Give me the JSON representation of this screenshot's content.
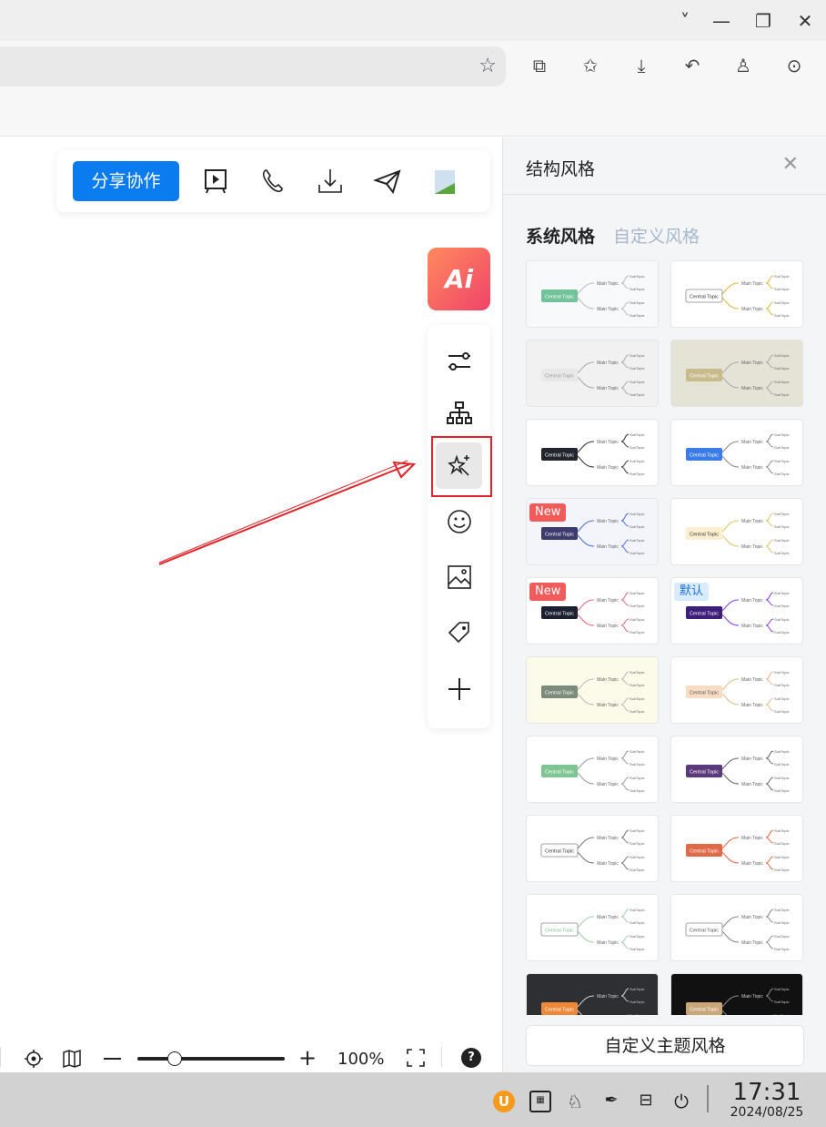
{
  "window": {
    "controls": [
      "chevron-down",
      "minimize",
      "restore",
      "close"
    ]
  },
  "browser": {
    "icons": [
      "extensions-icon",
      "collections-icon",
      "download-icon",
      "undo-icon",
      "profile-icon",
      "more-icon"
    ]
  },
  "toolbar": {
    "share_label": "分享协作",
    "icons": [
      "present-icon",
      "call-icon",
      "export-icon",
      "send-icon",
      "image-icon"
    ]
  },
  "ai": {
    "label": "Ai"
  },
  "sidetools": [
    "adjust-icon",
    "structure-icon",
    "magic-style-icon",
    "emoji-icon",
    "image-icon",
    "tag-icon",
    "add-icon"
  ],
  "bottom": {
    "zoom_percent": "100%",
    "zoom_level": 0.25,
    "help": "?"
  },
  "panel": {
    "title": "结构风格",
    "tabs": [
      {
        "label": "系统风格",
        "active": true
      },
      {
        "label": "自定义风格",
        "active": false
      }
    ],
    "thumb_text": {
      "central": "Central Topic",
      "main": "Main Topic",
      "sub": "SubTopic"
    },
    "themes": [
      {
        "bg": "#f8f9fa",
        "central": "#72c29a",
        "ctext": "#fff",
        "line": "#bbb"
      },
      {
        "bg": "#ffffff",
        "central": "#ffffff",
        "ctext": "#333",
        "line": "#e0b83a"
      },
      {
        "bg": "#f1f1f1",
        "central": "#e8e8e8",
        "ctext": "#999",
        "line": "#aaa"
      },
      {
        "bg": "#e5e3d6",
        "central": "#c9ba8c",
        "ctext": "#fff",
        "line": "#aaa"
      },
      {
        "bg": "#ffffff",
        "central": "#23262e",
        "ctext": "#fff",
        "line": "#333"
      },
      {
        "bg": "#ffffff",
        "central": "#3b7be8",
        "ctext": "#fff",
        "line": "#888"
      },
      {
        "bg": "#f4f5fb",
        "central": "#3d3b6e",
        "ctext": "#fff",
        "line": "#4a6fd8",
        "badge": "New"
      },
      {
        "bg": "#ffffff",
        "central": "#fcefd0",
        "ctext": "#333",
        "line": "#e2c36a"
      },
      {
        "bg": "#ffffff",
        "central": "#1d2030",
        "ctext": "#fff",
        "line": "#e06a7a",
        "badge": "New"
      },
      {
        "bg": "#ffffff",
        "central": "#3d1f7a",
        "ctext": "#fff",
        "line": "#8a3ce0",
        "badge": "默认"
      },
      {
        "bg": "#fcfbe9",
        "central": "#7d8b7c",
        "ctext": "#fff",
        "line": "#bbb"
      },
      {
        "bg": "#ffffff",
        "central": "#f8dcc4",
        "ctext": "#555",
        "line": "#e8b88a"
      },
      {
        "bg": "#ffffff",
        "central": "#7fc493",
        "ctext": "#fff",
        "line": "#999"
      },
      {
        "bg": "#ffffff",
        "central": "#5a3a7a",
        "ctext": "#fff",
        "line": "#666"
      },
      {
        "bg": "#ffffff",
        "central": "#ffffff",
        "ctext": "#333",
        "line": "#777"
      },
      {
        "bg": "#ffffff",
        "central": "#e06a48",
        "ctext": "#fff",
        "line": "#e06a48"
      },
      {
        "bg": "#ffffff",
        "central": "#ffffff",
        "ctext": "#7fc493",
        "line": "#9fd0aa"
      },
      {
        "bg": "#ffffff",
        "central": "#ffffff",
        "ctext": "#555",
        "line": "#888"
      },
      {
        "bg": "#2e2f33",
        "central": "#f0883a",
        "ctext": "#fff",
        "line": "#ccc"
      },
      {
        "bg": "#111111",
        "central": "#c8a67a",
        "ctext": "#fff",
        "line": "#888"
      }
    ],
    "custom_button": "自定义主题风格"
  },
  "taskbar": {
    "time": "17:31",
    "date": "2024/08/25",
    "tray": [
      "ime-icon",
      "keyboard-icon",
      "qq-icon",
      "pen-icon",
      "toggle-icon",
      "power-icon"
    ]
  }
}
